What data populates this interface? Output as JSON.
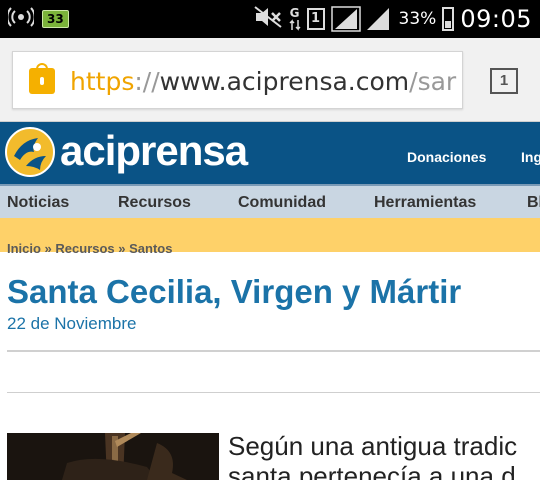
{
  "status_bar": {
    "notification_count": "33",
    "network_type": "G",
    "sim_slot": "1",
    "battery_percent": "33%",
    "battery_level": 0.33,
    "time": "09:05",
    "icons": [
      "radio-icon",
      "notification-badge",
      "mute-icon",
      "data-arrows-icon",
      "sim-icon",
      "signal-icon",
      "signal-icon",
      "battery-icon"
    ]
  },
  "browser": {
    "url_scheme": "https",
    "url_separator": "://",
    "url_host": "www.aciprensa.com",
    "url_path": "/sar",
    "tab_count": "1",
    "secure_color": "#f5b000"
  },
  "site": {
    "logo_text": "aciprensa",
    "header_links": [
      "Donaciones",
      "Ing"
    ],
    "nav": [
      "Noticias",
      "Recursos",
      "Comunidad",
      "Herramientas",
      "Bl"
    ],
    "brand_color": "#0a5386",
    "alert_color": "#fed169"
  },
  "article": {
    "breadcrumb": "Inicio » Recursos » Santos",
    "title": "Santa Cecilia, Virgen y Mártir",
    "date": "22 de Noviembre",
    "body_line1": "Según una antigua tradic",
    "body_line2": "santa pertenecía a una d",
    "title_color": "#1b73a8"
  }
}
